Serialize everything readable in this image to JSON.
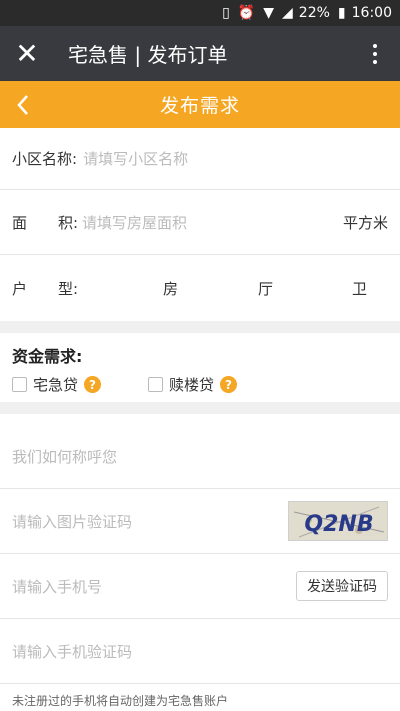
{
  "statusbar": {
    "battery": "22%",
    "time": "16:00"
  },
  "webview": {
    "title": "宅急售 | 发布订单"
  },
  "header": {
    "title": "发布需求"
  },
  "form": {
    "community": {
      "label": "小区名称:",
      "placeholder": "请填写小区名称"
    },
    "area": {
      "label_a": "面",
      "label_b": "积:",
      "placeholder": "请填写房屋面积",
      "unit": "平方米"
    },
    "layout": {
      "label_a": "户",
      "label_b": "型:",
      "room": "房",
      "hall": "厅",
      "bath": "卫"
    }
  },
  "funding": {
    "title": "资金需求:",
    "options": [
      {
        "label": "宅急贷",
        "checked": false
      },
      {
        "label": "赎楼贷",
        "checked": false
      }
    ],
    "help_glyph": "?"
  },
  "contact": {
    "name_placeholder": "我们如何称呼您",
    "captcha_placeholder": "请输入图片验证码",
    "captcha_text": "Q2NB",
    "phone_placeholder": "请输入手机号",
    "send_code_label": "发送验证码",
    "sms_placeholder": "请输入手机验证码",
    "note": "未注册过的手机将自动创建为宅急售账户"
  },
  "colors": {
    "accent": "#f5a623",
    "titlebar": "#393a3f"
  }
}
